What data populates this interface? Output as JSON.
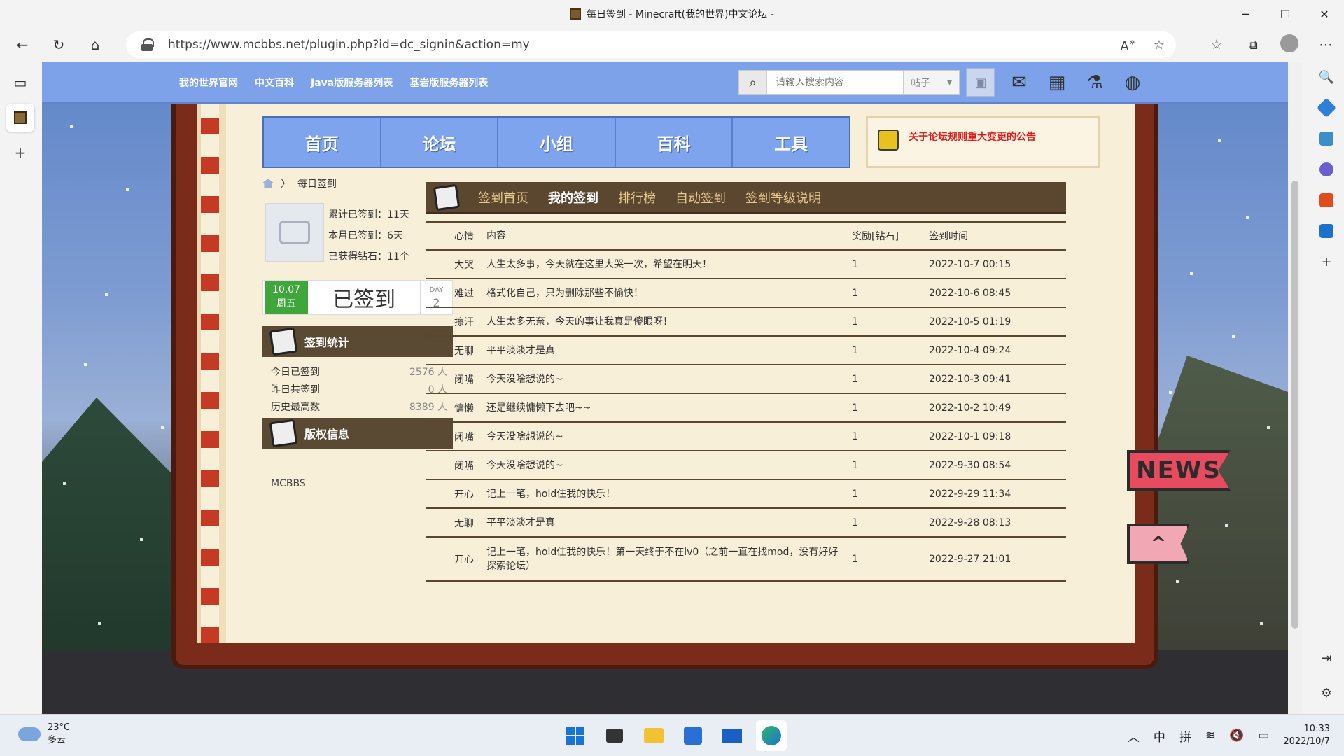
{
  "window": {
    "title": "每日签到 - Minecraft(我的世界)中文论坛 -",
    "controls": {
      "minimize": "─",
      "maximize": "☐",
      "close": "✕"
    }
  },
  "browser": {
    "url": "https://www.mcbbs.net/plugin.php?id=dc_signin&action=my",
    "address_icons": [
      "read-aloud-icon",
      "favorite-add-icon"
    ],
    "toolbar_icons": [
      "favorites-icon",
      "collections-icon",
      "profile-icon",
      "more-icon"
    ]
  },
  "site_nav": {
    "links": [
      "我的世界官网",
      "中文百科",
      "Java版服务器列表",
      "基岩版服务器列表"
    ],
    "search_placeholder": "请输入搜索内容",
    "search_type": "帖子"
  },
  "main_nav": [
    "首页",
    "论坛",
    "小组",
    "百科",
    "工具"
  ],
  "notice": "关于论坛规则重大变更的公告",
  "breadcrumb": "每日签到",
  "user_stats": [
    "累计已签到：11天",
    "本月已签到：6天",
    "已获得钻石：11个"
  ],
  "sign_card": {
    "date": "10.07",
    "weekday": "周五",
    "status": "已签到",
    "day_label": "DAY",
    "day_value": "2"
  },
  "sign_stats": {
    "title": "签到统计",
    "rows": [
      {
        "label": "今日已签到",
        "value": "2576 人"
      },
      {
        "label": "昨日共签到",
        "value": "0 人"
      },
      {
        "label": "历史最高数",
        "value": "8389 人"
      }
    ]
  },
  "copyright": {
    "title": "版权信息",
    "text": "MCBBS"
  },
  "tabs": [
    {
      "label": "签到首页",
      "active": false
    },
    {
      "label": "我的签到",
      "active": true
    },
    {
      "label": "排行榜",
      "active": false
    },
    {
      "label": "自动签到",
      "active": false
    },
    {
      "label": "签到等级说明",
      "active": false
    }
  ],
  "table": {
    "headers": [
      "心情",
      "内容",
      "奖励[钻石]",
      "签到时间"
    ],
    "rows": [
      [
        "大哭",
        "人生太多事，今天就在这里大哭一次，希望在明天！",
        "1",
        "2022-10-7 00:15"
      ],
      [
        "难过",
        "格式化自己，只为删除那些不愉快！",
        "1",
        "2022-10-6 08:45"
      ],
      [
        "擦汗",
        "人生太多无奈，今天的事让我真是傻眼呀！",
        "1",
        "2022-10-5 01:19"
      ],
      [
        "无聊",
        "平平淡淡才是真",
        "1",
        "2022-10-4 09:24"
      ],
      [
        "闭嘴",
        "今天没啥想说的~",
        "1",
        "2022-10-3 09:41"
      ],
      [
        "慵懒",
        "还是继续慵懒下去吧~~",
        "1",
        "2022-10-2 10:49"
      ],
      [
        "闭嘴",
        "今天没啥想说的~",
        "1",
        "2022-10-1 09:18"
      ],
      [
        "闭嘴",
        "今天没啥想说的~",
        "1",
        "2022-9-30 08:54"
      ],
      [
        "开心",
        "记上一笔，hold住我的快乐！",
        "1",
        "2022-9-29 11:34"
      ],
      [
        "无聊",
        "平平淡淡才是真",
        "1",
        "2022-9-28 08:13"
      ],
      [
        "开心",
        "记上一笔，hold住我的快乐！第一天终于不在lv0（之前一直在找mod，没有好好探索论坛）",
        "1",
        "2022-9-27 21:01"
      ]
    ]
  },
  "side_flags": {
    "news": "NEWS",
    "up": "^"
  },
  "taskbar": {
    "weather_temp": "23°C",
    "weather_desc": "多云",
    "ime_lang": "中",
    "ime_mode": "拼",
    "time": "10:33",
    "date": "2022/10/7"
  }
}
